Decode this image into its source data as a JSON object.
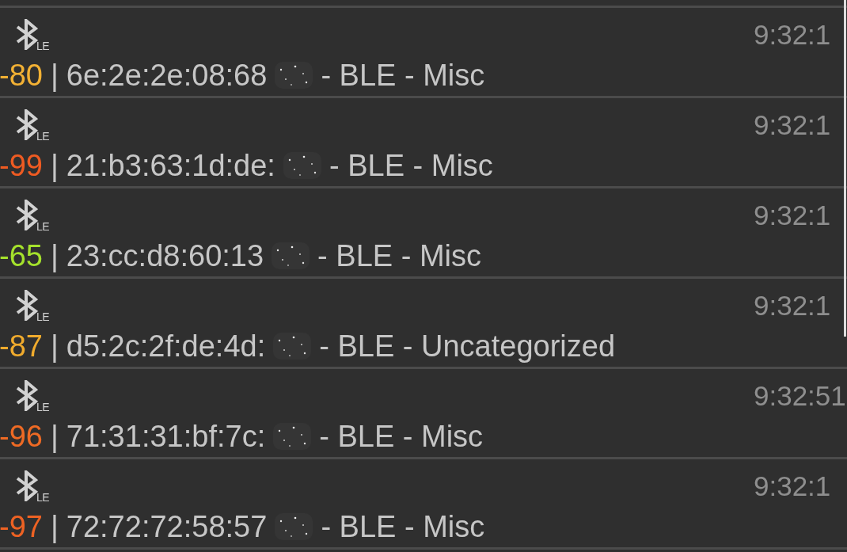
{
  "devices": [
    {
      "icon_label": "LE",
      "time": "9:32:1",
      "rssi": "-80",
      "color": "#f2b134",
      "separator": "|",
      "address": "6e:2e:2e:08:68",
      "redacted": true,
      "details": "- BLE - Misc"
    },
    {
      "icon_label": "LE",
      "time": "9:32:1",
      "rssi": "-99",
      "color": "#ee5b22",
      "separator": "|",
      "address": "21:b3:63:1d:de:",
      "redacted": true,
      "details": "- BLE - Misc"
    },
    {
      "icon_label": "LE",
      "time": "9:32:1",
      "rssi": "-65",
      "color": "#a5e22c",
      "separator": "|",
      "address": "23:cc:d8:60:13",
      "redacted": true,
      "details": "- BLE - Misc"
    },
    {
      "icon_label": "LE",
      "time": "9:32:1",
      "rssi": "-87",
      "color": "#f0ab2d",
      "separator": "|",
      "address": "d5:2c:2f:de:4d:",
      "redacted": true,
      "details": "- BLE - Uncategorized"
    },
    {
      "icon_label": "LE",
      "time": "9:32:51",
      "rssi": "-96",
      "color": "#ee6a24",
      "separator": "|",
      "address": "71:31:31:bf:7c:",
      "redacted": true,
      "details": "- BLE - Misc"
    },
    {
      "icon_label": "LE",
      "time": "9:32:1",
      "rssi": "-97",
      "color": "#ee6223",
      "separator": "|",
      "address": "72:72:72:58:57",
      "redacted": true,
      "details": "- BLE - Misc"
    }
  ]
}
